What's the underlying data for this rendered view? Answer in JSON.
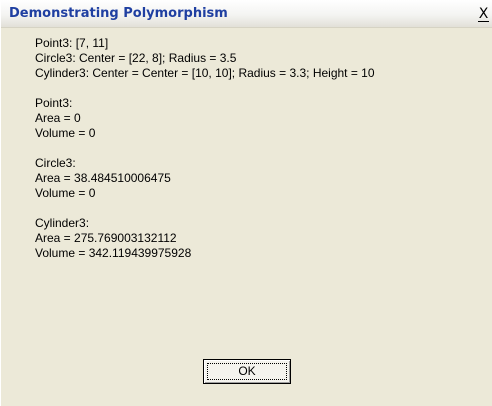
{
  "window": {
    "title": "Demonstrating Polymorphism",
    "close_label": "X"
  },
  "message": {
    "lines": [
      "Point3: [7, 11]",
      "Circle3: Center = [22, 8]; Radius = 3.5",
      "Cylinder3: Center = Center = [10, 10]; Radius = 3.3; Height = 10",
      "",
      "Point3:",
      "Area = 0",
      "Volume = 0",
      "",
      "Circle3:",
      "Area = 38.484510006475",
      "Volume = 0",
      "",
      "Cylinder3:",
      "Area = 275.769003132112",
      "Volume = 342.119439975928"
    ]
  },
  "buttons": {
    "ok_label": "OK"
  }
}
